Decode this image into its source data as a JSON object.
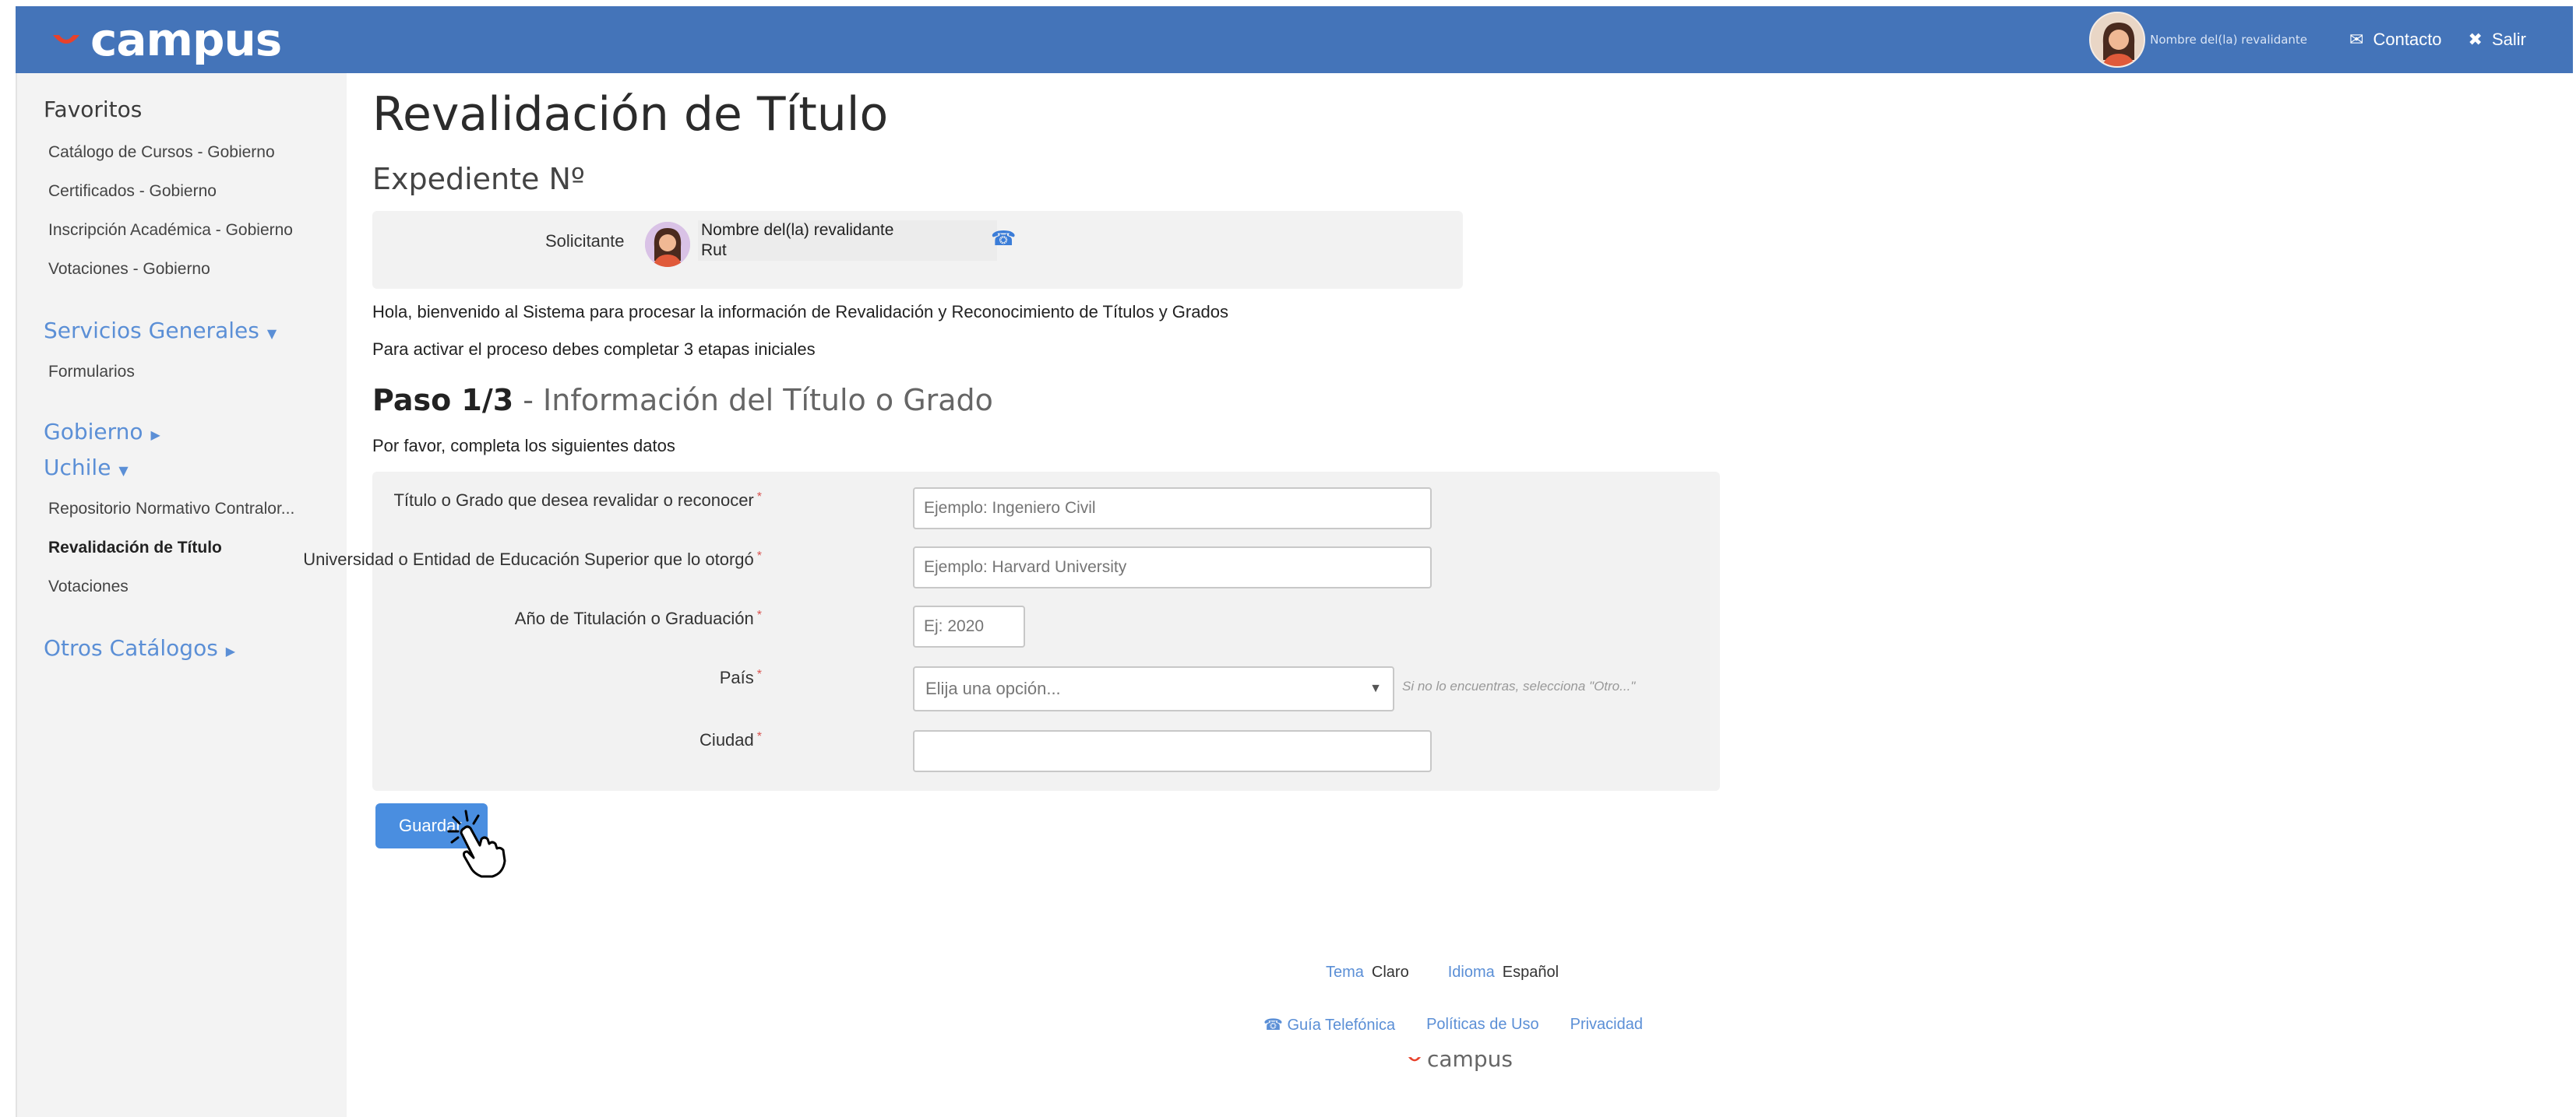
{
  "app": {
    "logo_text": "campus",
    "brand_color": "#4474b9",
    "accent_color": "#e8412b"
  },
  "topbar": {
    "user_name": "Nombre del(la) revalidante",
    "contact_label": "Contacto",
    "exit_label": "Salir",
    "contact_icon": "envelope-icon",
    "exit_icon": "close-icon"
  },
  "sidebar": {
    "favorites_title": "Favoritos",
    "favorites": [
      "Catálogo de Cursos - Gobierno",
      "Certificados - Gobierno",
      "Inscripción Académica - Gobierno",
      "Votaciones - Gobierno"
    ],
    "services_title": "Servicios Generales",
    "services": [
      "Formularios"
    ],
    "gobierno_title": "Gobierno",
    "uchile_title": "Uchile",
    "uchile_items": [
      "Repositorio Normativo Contralor...",
      "Revalidación de Título",
      "Votaciones"
    ],
    "other_title": "Otros Catálogos"
  },
  "main": {
    "title": "Revalidación de Título",
    "subtitle": "Expediente Nº",
    "applicant_label": "Solicitante",
    "applicant_name": "Nombre del(la) revalidante",
    "applicant_rut": "Rut",
    "welcome_text": "Hola, bienvenido al Sistema para procesar la información de Revalidación y Reconocimiento de Títulos y Grados",
    "activate_text": "Para activar el proceso debes completar 3 etapas iniciales",
    "step_strong": "Paso 1/3",
    "step_rest": " - Información del Título o Grado",
    "step_instructions": "Por favor, completa los siguientes datos"
  },
  "form": {
    "title_label": "Título o Grado que desea revalidar o reconocer",
    "title_placeholder": "Ejemplo: Ingeniero Civil",
    "university_label": "Universidad o Entidad de Educación Superior que lo otorgó",
    "university_placeholder": "Ejemplo: Harvard University",
    "year_label": "Año de Titulación o Graduación",
    "year_placeholder": "Ej: 2020",
    "country_label": "País",
    "country_value": "Elija una opción...",
    "country_hint": "Si no lo encuentras, selecciona \"Otro...\"",
    "city_label": "Ciudad",
    "city_value": "",
    "required_mark": "*",
    "save_label": "Guardar"
  },
  "footer": {
    "theme_key": "Tema",
    "theme_value": "Claro",
    "language_key": "Idioma",
    "language_value": "Español",
    "phone_guide": "Guía Telefónica",
    "terms": "Políticas de Uso",
    "privacy": "Privacidad",
    "logo_text": "campus"
  }
}
